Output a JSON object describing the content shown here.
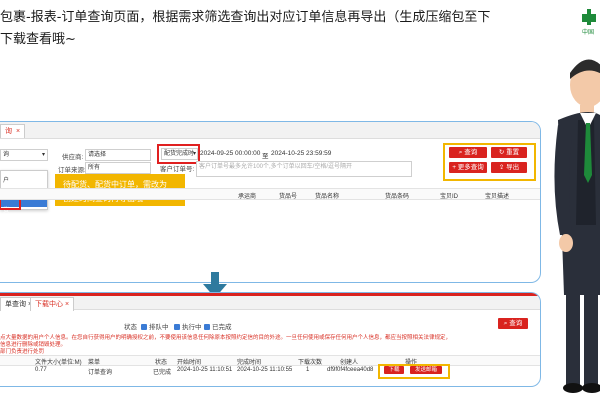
{
  "header": {
    "line1": "包裹-报表-订单查询页面，根据需求筛选查询出对应订单信息再导出（生成压缩包至下",
    "line2": "下载查看哦~",
    "logo_text": "中国"
  },
  "colors": {
    "accent_red": "#d9231f",
    "highlight_yellow": "#f2b600",
    "arrow": "#2e7a9e",
    "panel_border": "#7fb8e6"
  },
  "top_panel": {
    "tab_label": "询",
    "tab_close": "×",
    "filters": {
      "supplier_label": "供应商:",
      "supplier_value": "请选择",
      "order_source_label": "订单来源:",
      "order_source_value": "所有",
      "date_type_value": "配货完成时",
      "date_start": "2024-09-25 00:00:00",
      "date_to": "至",
      "date_end": "2024-10-25 23:59:59",
      "order_no_label": "客户订单号:",
      "order_no_placeholder": "客户订单号最多允许100个,多个订单以回车/空格/逗号隔开"
    },
    "left_select_value": "询",
    "dropdown_items": [
      "户",
      "",
      "货"
    ],
    "buttons": {
      "search": "查询",
      "reset": "重置",
      "more_search": "更多查询",
      "export": "导出"
    },
    "tooltip": {
      "line1": "待配货、配货中订单，需改为",
      "line2": "创建时间查询再导出哦"
    },
    "columns": [
      "承运商",
      "货品号",
      "货品名称",
      "货品条码",
      "宝贝ID",
      "宝贝描述"
    ]
  },
  "bottom_panel": {
    "tabs": [
      {
        "label": "单查询",
        "close": "×"
      },
      {
        "label": "下载中心",
        "close": "×"
      }
    ],
    "status_label": "状态",
    "statuses": [
      "排队中",
      "执行中",
      "已完成"
    ],
    "search_button": "查询",
    "notes": [
      "点大量数据的用户个人信息。在您自行获得用户的明确授权之前，不要使用该信息任何除原本按照约定信的目的外途。一旦任何使用或保存任何用户个人信息，都应当按照相关法律规定，",
      "信息进行删除或销毁处理。",
      "部门负责进行处罚"
    ],
    "table": {
      "headers": [
        "文件大小(单位:M)",
        "菜单",
        "状态",
        "开始时间",
        "完成时间",
        "下载次数",
        "创建人",
        "操作"
      ],
      "row": {
        "size": "0.77",
        "menu": "订单查询",
        "status": "已完成",
        "start": "2024-10-25 11:10:51",
        "end": "2024-10-25 11:10:55",
        "downloads": "1",
        "creator": "df9f0f4fceea40d8",
        "actions": [
          "下载",
          "发送邮箱"
        ]
      }
    }
  }
}
